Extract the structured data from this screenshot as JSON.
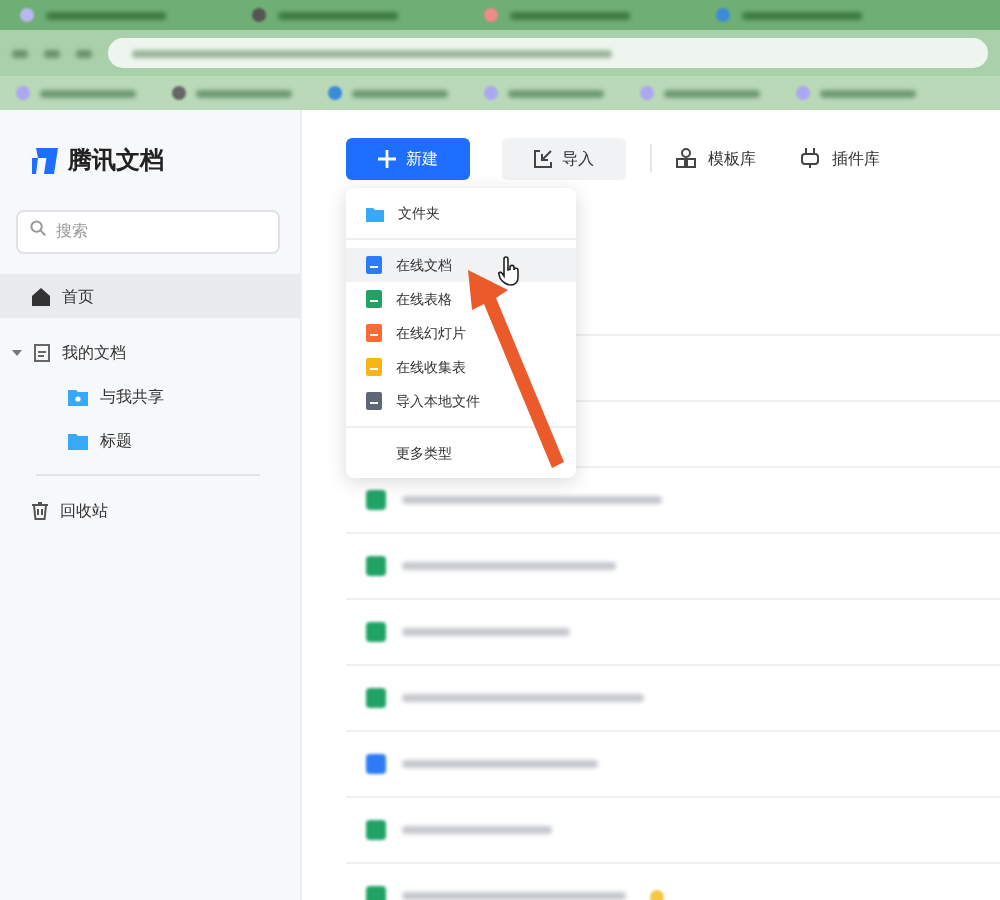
{
  "app": {
    "logo_text": "腾讯文档"
  },
  "search": {
    "placeholder": "搜索"
  },
  "sidebar": {
    "items": [
      {
        "label": "首页",
        "selected": true
      },
      {
        "label": "我的文档",
        "selected": false,
        "expanded": true,
        "children": [
          {
            "label": "与我共享",
            "selected": false
          },
          {
            "label": "标题",
            "selected": false
          }
        ]
      }
    ],
    "trash": {
      "label": "回收站"
    }
  },
  "toolbar": {
    "new_button": "新建",
    "import_button": "导入",
    "links": [
      {
        "label": "模板库"
      },
      {
        "label": "插件库"
      }
    ]
  },
  "new_menu": {
    "items": [
      {
        "label": "文件夹",
        "kind": "folder",
        "selected": false
      },
      {
        "label": "在线文档",
        "kind": "doc",
        "selected": true
      },
      {
        "label": "在线表格",
        "kind": "sheet",
        "selected": false
      },
      {
        "label": "在线幻灯片",
        "kind": "slide",
        "selected": false
      },
      {
        "label": "在线收集表",
        "kind": "form",
        "selected": false
      },
      {
        "label": "导入本地文件",
        "kind": "import",
        "selected": false
      },
      {
        "label": "更多类型",
        "kind": "more",
        "selected": false
      }
    ]
  },
  "file_list": {
    "rows": [
      {
        "kind": "sheet",
        "starred": false
      },
      {
        "kind": "sheet",
        "starred": false
      },
      {
        "kind": "sheet",
        "starred": false
      },
      {
        "kind": "sheet",
        "starred": false
      },
      {
        "kind": "doc",
        "starred": false
      },
      {
        "kind": "sheet",
        "starred": false
      },
      {
        "kind": "sheet",
        "starred": true
      }
    ]
  }
}
